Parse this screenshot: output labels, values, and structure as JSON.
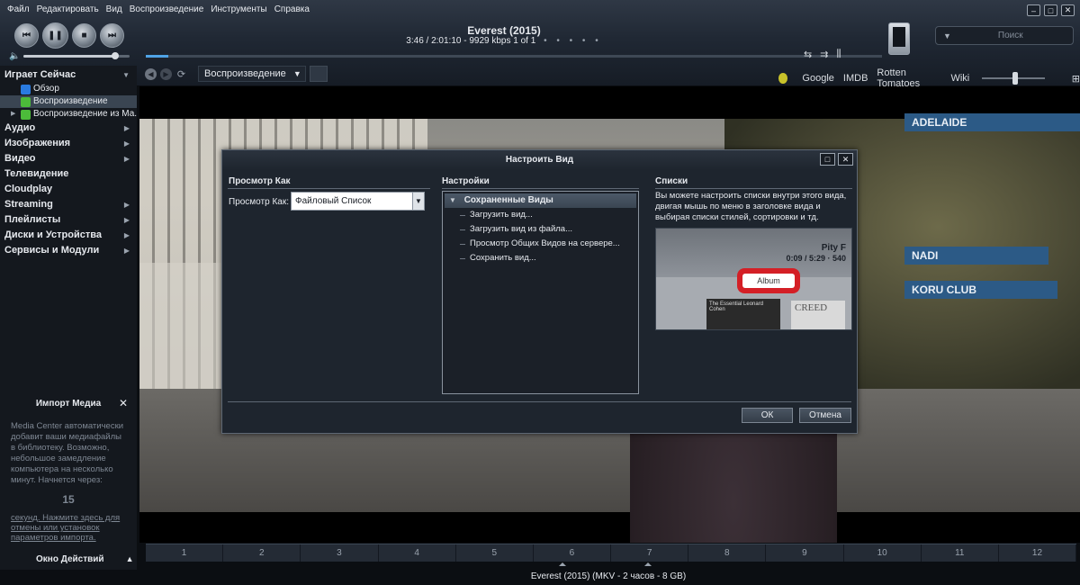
{
  "menu": [
    "Файл",
    "Редактировать",
    "Вид",
    "Воспроизведение",
    "Инструменты",
    "Справка"
  ],
  "now_playing": {
    "title": "Everest (2015)",
    "info": "3:46 / 2:01:10 - 9929 kbps  1 of 1",
    "dots": "• • • • •",
    "progress": 0.031
  },
  "volume": 0.86,
  "search": {
    "placeholder": "Поиск"
  },
  "view_dropdown": "Воспроизведение",
  "links": [
    "Google",
    "IMDB",
    "Rotten Tomatoes",
    "Wiki"
  ],
  "sidebar": {
    "playing_now": "Играет Сейчас",
    "sub": [
      {
        "label": "Обзор",
        "icon": "play-icon",
        "color": "#2a7be0"
      },
      {
        "label": "Воспроизведение",
        "icon": "play-icon",
        "color": "#4cbb3a"
      },
      {
        "label": "Воспроизведение из Ма...",
        "icon": "home-icon",
        "color": "#4cbb3a"
      }
    ],
    "sections": [
      "Аудио",
      "Изображения",
      "Видео",
      "Телевидение",
      "Cloudplay",
      "Streaming",
      "Плейлисты",
      "Диски и Устройства",
      "Сервисы и Модули"
    ]
  },
  "import": {
    "title": "Импорт Медиа",
    "body": "Media Center автоматически добавит ваши медиафайлы в библиотеку. Возможно, небольшое замедление компьютера на несколько минут. Начнется через:",
    "count": "15",
    "link": "секунд. Нажмите здесь для отмены или установок параметров импорта."
  },
  "actions": "Окно Действий",
  "video_signs": [
    "ADELAIDE",
    "NADI",
    "KORU CLUB"
  ],
  "dialog": {
    "title": "Настроить Вид",
    "view_as_header": "Просмотр Как",
    "view_as_label": "Просмотр Как:",
    "view_as_value": "Файловый Список",
    "settings_header": "Настройки",
    "saved_views": "Сохраненные Виды",
    "settings_items": [
      "Загрузить вид...",
      "Загрузить вид из файла...",
      "Просмотр Общих Видов на сервере...",
      "Сохранить вид..."
    ],
    "lists_header": "Списки",
    "lists_text": "Вы можете настроить списки внутри этого вида, двигая мышь по меню в заголовке вида и выбирая списки стилей, сортировки и тд.",
    "preview_title": "Pity F",
    "preview_time": "0:09 / 5:29 · 540",
    "preview_album": "Album",
    "preview_cover1": "The Essential Leonard Cohen",
    "preview_cover2": "CREED",
    "ok": "ОК",
    "cancel": "Отмена"
  },
  "timeline": [
    "1",
    "2",
    "3",
    "4",
    "5",
    "6",
    "7",
    "8",
    "9",
    "10",
    "11",
    "12"
  ],
  "status": "Everest (2015) (MKV - 2 часов - 8 GB)"
}
